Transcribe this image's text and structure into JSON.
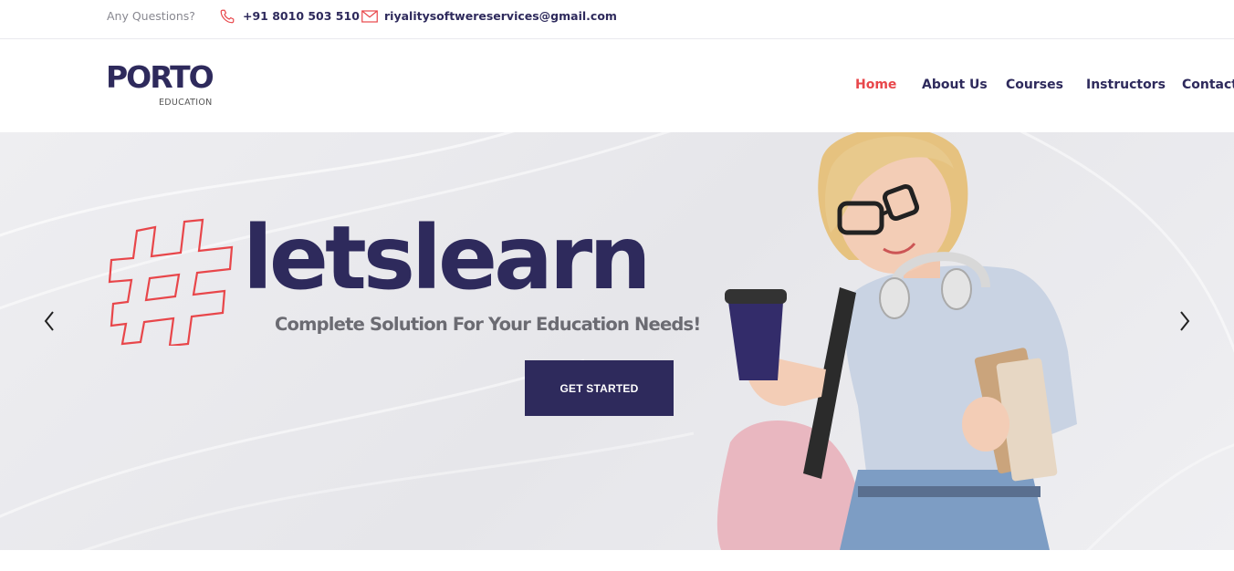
{
  "topbar": {
    "question_label": "Any Questions?",
    "phone": "+91 8010 503 510",
    "email": "riyalitysoftwereservices@gmail.com",
    "phone_icon": "phone-icon",
    "mail_icon": "mail-icon"
  },
  "logo": {
    "word": "PORTO",
    "subtitle": "EDUCATION"
  },
  "nav": {
    "items": [
      {
        "label": "Home",
        "active": true
      },
      {
        "label": "About Us",
        "active": false
      },
      {
        "label": "Courses",
        "active": false
      },
      {
        "label": "Instructors",
        "active": false
      },
      {
        "label": "Contact Us",
        "active": false
      }
    ]
  },
  "hero": {
    "headline": "letslearn",
    "subline": "Complete Solution For Your Education Needs!",
    "cta_label": "GET STARTED",
    "prev_icon": "chevron-left-icon",
    "next_icon": "chevron-right-icon"
  },
  "colors": {
    "brand": "#2e2a5c",
    "accent": "#e8464a",
    "hero_bg": "#ebebee"
  }
}
